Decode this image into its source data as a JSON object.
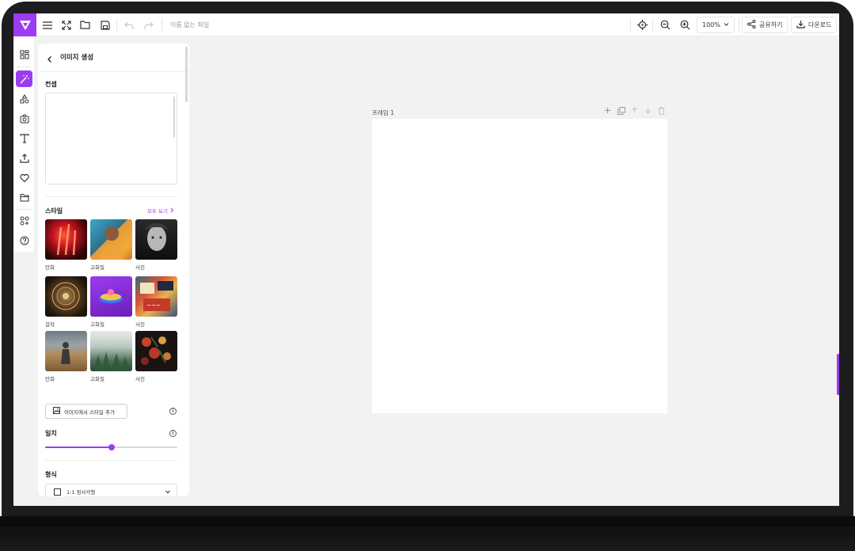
{
  "topbar": {
    "file_name": "이름 없는 파일",
    "zoom": "100%",
    "share_label": "공유하기",
    "download_label": "다운로드"
  },
  "rail": {
    "items": [
      "templates-icon",
      "magic-wand-icon",
      "shapes-icon",
      "camera-icon",
      "text-icon",
      "upload-icon",
      "heart-icon",
      "folder-icon",
      "apps-icon",
      "help-icon"
    ],
    "active": "magic-wand-icon"
  },
  "panel": {
    "title": "이미지 생성",
    "prompt_label": "컨셉",
    "prompt_value": "",
    "style_label": "스타일",
    "see_all": "모두 보기",
    "styles": [
      {
        "caption": "만화"
      },
      {
        "caption": "고화질"
      },
      {
        "caption": "사진"
      },
      {
        "caption": "걸작"
      },
      {
        "caption": "고화질"
      },
      {
        "caption": "사진"
      },
      {
        "caption": "만화"
      },
      {
        "caption": "고화질"
      },
      {
        "caption": "사진"
      }
    ],
    "add_style_button": "이미지에서 스타일 추가",
    "match_label": "일치",
    "match_value": 0.5,
    "format_label": "형식",
    "format_value": "1:1 정사각형"
  },
  "canvas": {
    "frame_label": "프레임 1"
  },
  "colors": {
    "accent": "#9b3cf0",
    "canvas_bg": "#f2f2f2"
  }
}
